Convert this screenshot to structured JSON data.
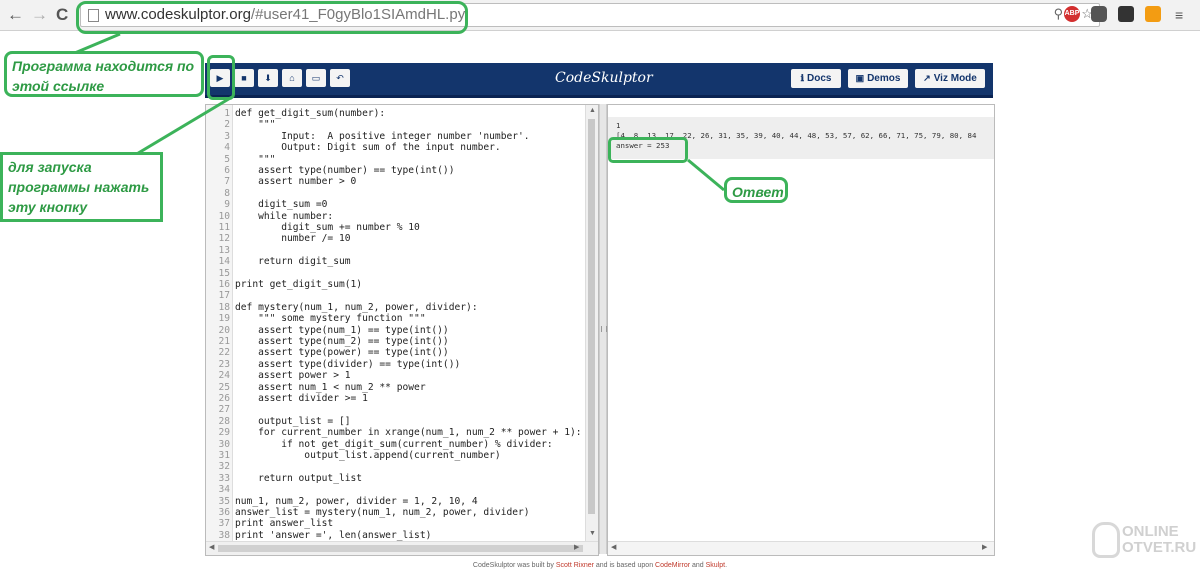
{
  "browser": {
    "back_icon": "←",
    "forward_icon": "→",
    "reload_icon": "C",
    "url_host": "www.codeskulptor.org",
    "url_path": "/#user41_F0gyBlo1SIAmdHL.py",
    "zoom_icon": "⚲",
    "translate_icon": "⇄",
    "star_icon": "☆",
    "ext_abp": "ABP"
  },
  "app": {
    "title": "CodeSkulptor",
    "toolbar": {
      "run_icon": "▶",
      "save_icon": "■",
      "download_icon": "⬇",
      "fresh_icon": "⌂",
      "open_icon": "▭",
      "reset_icon": "↶"
    },
    "docs_label": "Docs",
    "demos_label": "Demos",
    "vizmode_label": "Viz Mode",
    "docs_icon": "ℹ",
    "demos_icon": "▣",
    "vizmode_icon": "↗",
    "accent_color": "#13356c"
  },
  "code_lines": [
    {
      "n": "1",
      "t": "def get_digit_sum(number):"
    },
    {
      "n": "2",
      "t": "    \"\"\""
    },
    {
      "n": "3",
      "t": "        Input:  A positive integer number 'number'."
    },
    {
      "n": "4",
      "t": "        Output: Digit sum of the input number."
    },
    {
      "n": "5",
      "t": "    \"\"\""
    },
    {
      "n": "6",
      "t": "    assert type(number) == type(int())"
    },
    {
      "n": "7",
      "t": "    assert number > 0"
    },
    {
      "n": "8",
      "t": ""
    },
    {
      "n": "9",
      "t": "    digit_sum =0"
    },
    {
      "n": "10",
      "t": "    while number:"
    },
    {
      "n": "11",
      "t": "        digit_sum += number % 10"
    },
    {
      "n": "12",
      "t": "        number /= 10"
    },
    {
      "n": "13",
      "t": ""
    },
    {
      "n": "14",
      "t": "    return digit_sum"
    },
    {
      "n": "15",
      "t": ""
    },
    {
      "n": "16",
      "t": "print get_digit_sum(1)"
    },
    {
      "n": "17",
      "t": ""
    },
    {
      "n": "18",
      "t": "def mystery(num_1, num_2, power, divider):"
    },
    {
      "n": "19",
      "t": "    \"\"\" some mystery function \"\"\""
    },
    {
      "n": "20",
      "t": "    assert type(num_1) == type(int())"
    },
    {
      "n": "21",
      "t": "    assert type(num_2) == type(int())"
    },
    {
      "n": "22",
      "t": "    assert type(power) == type(int())"
    },
    {
      "n": "23",
      "t": "    assert type(divider) == type(int())"
    },
    {
      "n": "24",
      "t": "    assert power > 1"
    },
    {
      "n": "25",
      "t": "    assert num_1 < num_2 ** power"
    },
    {
      "n": "26",
      "t": "    assert divider >= 1"
    },
    {
      "n": "27",
      "t": ""
    },
    {
      "n": "28",
      "t": "    output_list = []"
    },
    {
      "n": "29",
      "t": "    for current_number in xrange(num_1, num_2 ** power + 1):"
    },
    {
      "n": "30",
      "t": "        if not get_digit_sum(current_number) % divider:"
    },
    {
      "n": "31",
      "t": "            output_list.append(current_number)"
    },
    {
      "n": "32",
      "t": ""
    },
    {
      "n": "33",
      "t": "    return output_list"
    },
    {
      "n": "34",
      "t": ""
    },
    {
      "n": "35",
      "t": "num_1, num_2, power, divider = 1, 2, 10, 4"
    },
    {
      "n": "36",
      "t": "answer_list = mystery(num_1, num_2, power, divider)"
    },
    {
      "n": "37",
      "t": "print answer_list"
    },
    {
      "n": "38",
      "t": "print 'answer =', len(answer_list)"
    }
  ],
  "output": {
    "line1": "1",
    "line2": "[4, 8, 13, 17, 22, 26, 31, 35, 39, 40, 44, 48, 53, 57, 62, 66, 71, 75, 79, 80, 84",
    "line3": "answer = 253"
  },
  "footer": {
    "prefix": "CodeSkulptor was built by ",
    "author": "Scott Rixner",
    "middle": " and is based upon ",
    "lib1": "CodeMirror",
    "and": " and ",
    "lib2": "Skulpt",
    "suffix": "."
  },
  "annotations": {
    "link_note": "Программа находится по этой ссылке",
    "run_note": "для запуска программы нажать эту кнопку",
    "answer_note": "Ответ",
    "color": "#3cb35a"
  },
  "watermark": {
    "line1": "ONLINE",
    "line2": "OTVET.RU"
  }
}
